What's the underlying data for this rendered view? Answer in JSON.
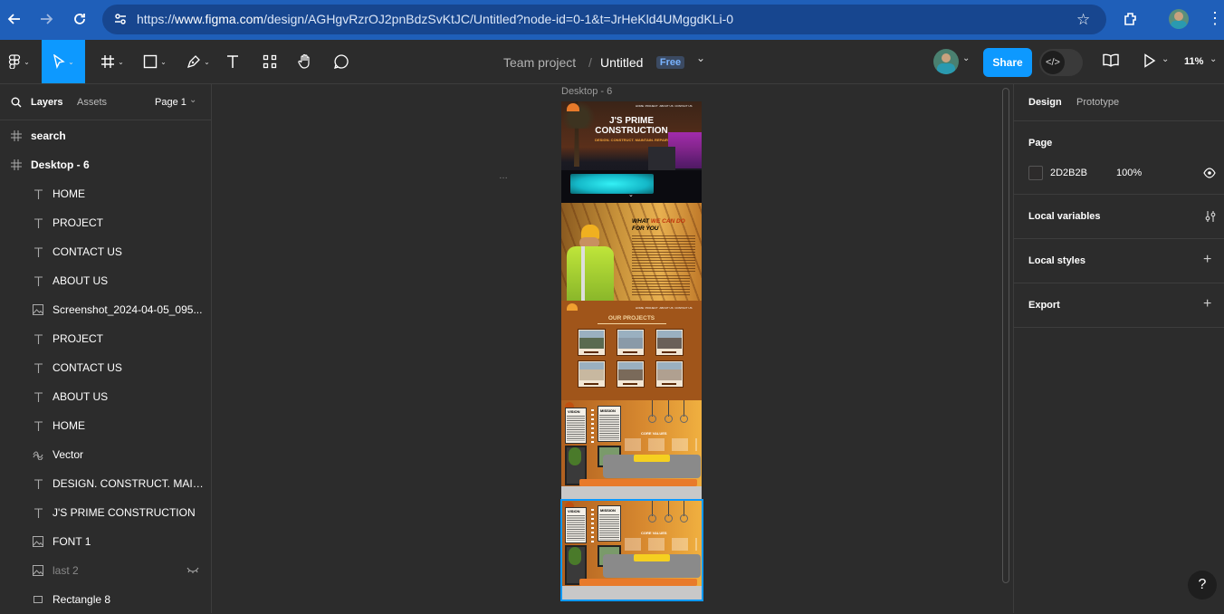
{
  "browser": {
    "url_prefix": "https://",
    "url_domain": "www.figma.com",
    "url_rest": "/design/AGHgvRzrOJ2pnBdzSvKtJC/Untitled?node-id=0-1&t=JrHeKld4UMggdKLi-0"
  },
  "toolbar": {
    "team": "Team project",
    "separator": "/",
    "file_name": "Untitled",
    "plan_badge": "Free",
    "share_label": "Share",
    "zoom": "11%"
  },
  "left_panel": {
    "tab_layers": "Layers",
    "tab_assets": "Assets",
    "page_selector": "Page 1",
    "layers": [
      {
        "label": "search",
        "icon": "frame-icon",
        "top_level": true
      },
      {
        "label": "Desktop - 6",
        "icon": "frame-icon",
        "top_level": true
      },
      {
        "label": "HOME",
        "icon": "text-icon"
      },
      {
        "label": "PROJECT",
        "icon": "text-icon"
      },
      {
        "label": "CONTACT US",
        "icon": "text-icon"
      },
      {
        "label": "ABOUT US",
        "icon": "text-icon"
      },
      {
        "label": "Screenshot_2024-04-05_095...",
        "icon": "image-icon"
      },
      {
        "label": "PROJECT",
        "icon": "text-icon"
      },
      {
        "label": "CONTACT US",
        "icon": "text-icon"
      },
      {
        "label": "ABOUT US",
        "icon": "text-icon"
      },
      {
        "label": "HOME",
        "icon": "text-icon"
      },
      {
        "label": "Vector",
        "icon": "vector-icon"
      },
      {
        "label": "DESIGN. CONSTRUCT. MAIN...",
        "icon": "text-icon"
      },
      {
        "label": "J'S PRIME CONSTRUCTION",
        "icon": "text-icon"
      },
      {
        "label": "FONT 1",
        "icon": "image-icon"
      },
      {
        "label": "last 2",
        "icon": "image-icon",
        "hidden": true
      },
      {
        "label": "Rectangle 8",
        "icon": "rectangle-icon"
      }
    ]
  },
  "canvas": {
    "frame_label": "Desktop - 6",
    "hero_title_1": "J'S PRIME",
    "hero_title_2": "CONSTRUCTION",
    "hero_tagline": "DESIGN. CONSTRUCT. MAINTAIN. REPAIR",
    "nav": [
      "HOME",
      "PROJECT",
      "ABOUT US",
      "CONTACT US"
    ],
    "what_title_1": "WHAT",
    "what_title_2": "WE CAN DO",
    "what_title_3": "FOR YOU",
    "projects_title": "OUR PROJECTS",
    "vision": "VISION",
    "mission": "MISSION",
    "core_values": "CORE VALUES"
  },
  "right_panel": {
    "tab_design": "Design",
    "tab_prototype": "Prototype",
    "page_title": "Page",
    "page_color": "2D2B2B",
    "page_opacity": "100%",
    "local_variables": "Local variables",
    "local_styles": "Local styles",
    "export": "Export"
  },
  "colors": {
    "accent": "#0d99ff",
    "browser_bar": "#1f5fb9",
    "ui_bg": "#2c2c2c",
    "design_orange": "#a0551a"
  }
}
